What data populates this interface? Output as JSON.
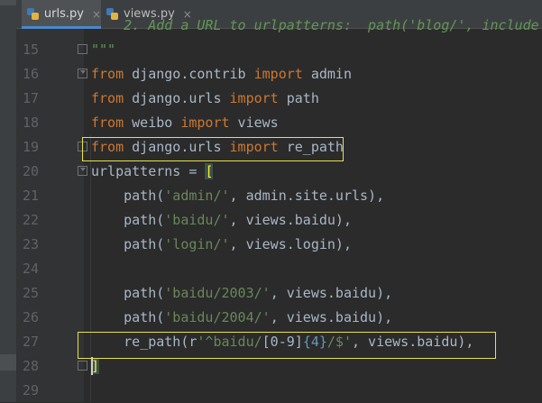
{
  "tabs": [
    {
      "label": "urls.py",
      "close": "×",
      "active": true
    },
    {
      "label": "views.py",
      "close": "×",
      "active": false
    }
  ],
  "lines": [
    {
      "n": "",
      "segments": [
        {
          "t": "    2. Add a URL to urlpatterns:  path('blog/', include",
          "c": "cm"
        }
      ]
    },
    {
      "n": "15",
      "fold": "end",
      "segments": [
        {
          "t": "\"\"\"",
          "c": "cm"
        }
      ]
    },
    {
      "n": "16",
      "fold": "start",
      "segments": [
        {
          "t": "from",
          "c": "kw"
        },
        {
          "t": " django.contrib ",
          "c": ""
        },
        {
          "t": "import",
          "c": "kw"
        },
        {
          "t": " admin",
          "c": ""
        }
      ]
    },
    {
      "n": "17",
      "segments": [
        {
          "t": "from",
          "c": "kw"
        },
        {
          "t": " django.urls ",
          "c": ""
        },
        {
          "t": "import",
          "c": "kw"
        },
        {
          "t": " path",
          "c": ""
        }
      ]
    },
    {
      "n": "18",
      "segments": [
        {
          "t": "from",
          "c": "kw"
        },
        {
          "t": " weibo ",
          "c": ""
        },
        {
          "t": "import",
          "c": "kw"
        },
        {
          "t": " views",
          "c": ""
        }
      ]
    },
    {
      "n": "19",
      "fold": "end",
      "segments": [
        {
          "t": "from",
          "c": "kw"
        },
        {
          "t": " django.urls ",
          "c": ""
        },
        {
          "t": "import",
          "c": "kw"
        },
        {
          "t": " re_path",
          "c": ""
        }
      ]
    },
    {
      "n": "20",
      "fold": "start",
      "segments": [
        {
          "t": "urlpatterns = ",
          "c": ""
        },
        {
          "t": "[",
          "c": "sel-bracket"
        }
      ]
    },
    {
      "n": "21",
      "segments": [
        {
          "t": "    path(",
          "c": ""
        },
        {
          "t": "'admin/'",
          "c": "str"
        },
        {
          "t": ", admin.site.urls),",
          "c": ""
        }
      ]
    },
    {
      "n": "22",
      "segments": [
        {
          "t": "    path(",
          "c": ""
        },
        {
          "t": "'baidu/'",
          "c": "str"
        },
        {
          "t": ", views.baidu),",
          "c": ""
        }
      ]
    },
    {
      "n": "23",
      "segments": [
        {
          "t": "    path(",
          "c": ""
        },
        {
          "t": "'login/'",
          "c": "str"
        },
        {
          "t": ", views.login),",
          "c": ""
        }
      ]
    },
    {
      "n": "24",
      "segments": []
    },
    {
      "n": "25",
      "segments": [
        {
          "t": "    path(",
          "c": ""
        },
        {
          "t": "'baidu/2003/'",
          "c": "str"
        },
        {
          "t": ", views.baidu),",
          "c": ""
        }
      ]
    },
    {
      "n": "26",
      "segments": [
        {
          "t": "    path(",
          "c": ""
        },
        {
          "t": "'baidu/2004/'",
          "c": "str"
        },
        {
          "t": ", views.baidu),",
          "c": ""
        }
      ]
    },
    {
      "n": "27",
      "segments": [
        {
          "t": "    re_path(r",
          "c": ""
        },
        {
          "t": "'^baidu/",
          "c": "str"
        },
        {
          "t": "[0-9]",
          "c": ""
        },
        {
          "t": "{4}",
          "c": "num"
        },
        {
          "t": "/$",
          "c": "str"
        },
        {
          "t": "'",
          "c": "str"
        },
        {
          "t": ", views.baidu),",
          "c": ""
        }
      ]
    },
    {
      "n": "28",
      "fold": "end",
      "segments": [
        {
          "t": "]",
          "c": "sel-bracket"
        }
      ]
    },
    {
      "n": "29",
      "segments": []
    }
  ],
  "colors": {
    "highlight": "#e6e04f",
    "tab_accent": "#4a88c7"
  },
  "icons": {
    "tab": "python-file-icon",
    "close": "close-icon"
  }
}
